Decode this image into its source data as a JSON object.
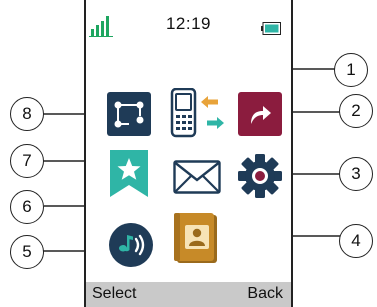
{
  "status": {
    "time": "12:19",
    "signal_icon": "signal-strength-icon",
    "battery_icon": "battery-icon"
  },
  "softkeys": {
    "left": "Select",
    "right": "Back"
  },
  "menu_icons": [
    {
      "name": "connections-icon",
      "callout": "8"
    },
    {
      "name": "phone-transfer-icon",
      "callout": "1"
    },
    {
      "name": "shortcut-arrow-icon",
      "callout": "2"
    },
    {
      "name": "favorites-icon",
      "callout": "7"
    },
    {
      "name": "messages-icon",
      "callout": "6"
    },
    {
      "name": "settings-gear-icon",
      "callout": "3"
    },
    {
      "name": "audio-icon",
      "callout": "5"
    },
    {
      "name": "contacts-icon",
      "callout": "4"
    }
  ],
  "callouts": {
    "c1": "1",
    "c2": "2",
    "c3": "3",
    "c4": "4",
    "c5": "5",
    "c6": "6",
    "c7": "7",
    "c8": "8"
  },
  "colors": {
    "navy": "#1f3b57",
    "maroon": "#8b1c3e",
    "teal": "#2fb5a6",
    "orange": "#e8a33a",
    "gold": "#c78a28",
    "screen_bar": "#c9c9c9",
    "signal_green": "#1ea660"
  }
}
